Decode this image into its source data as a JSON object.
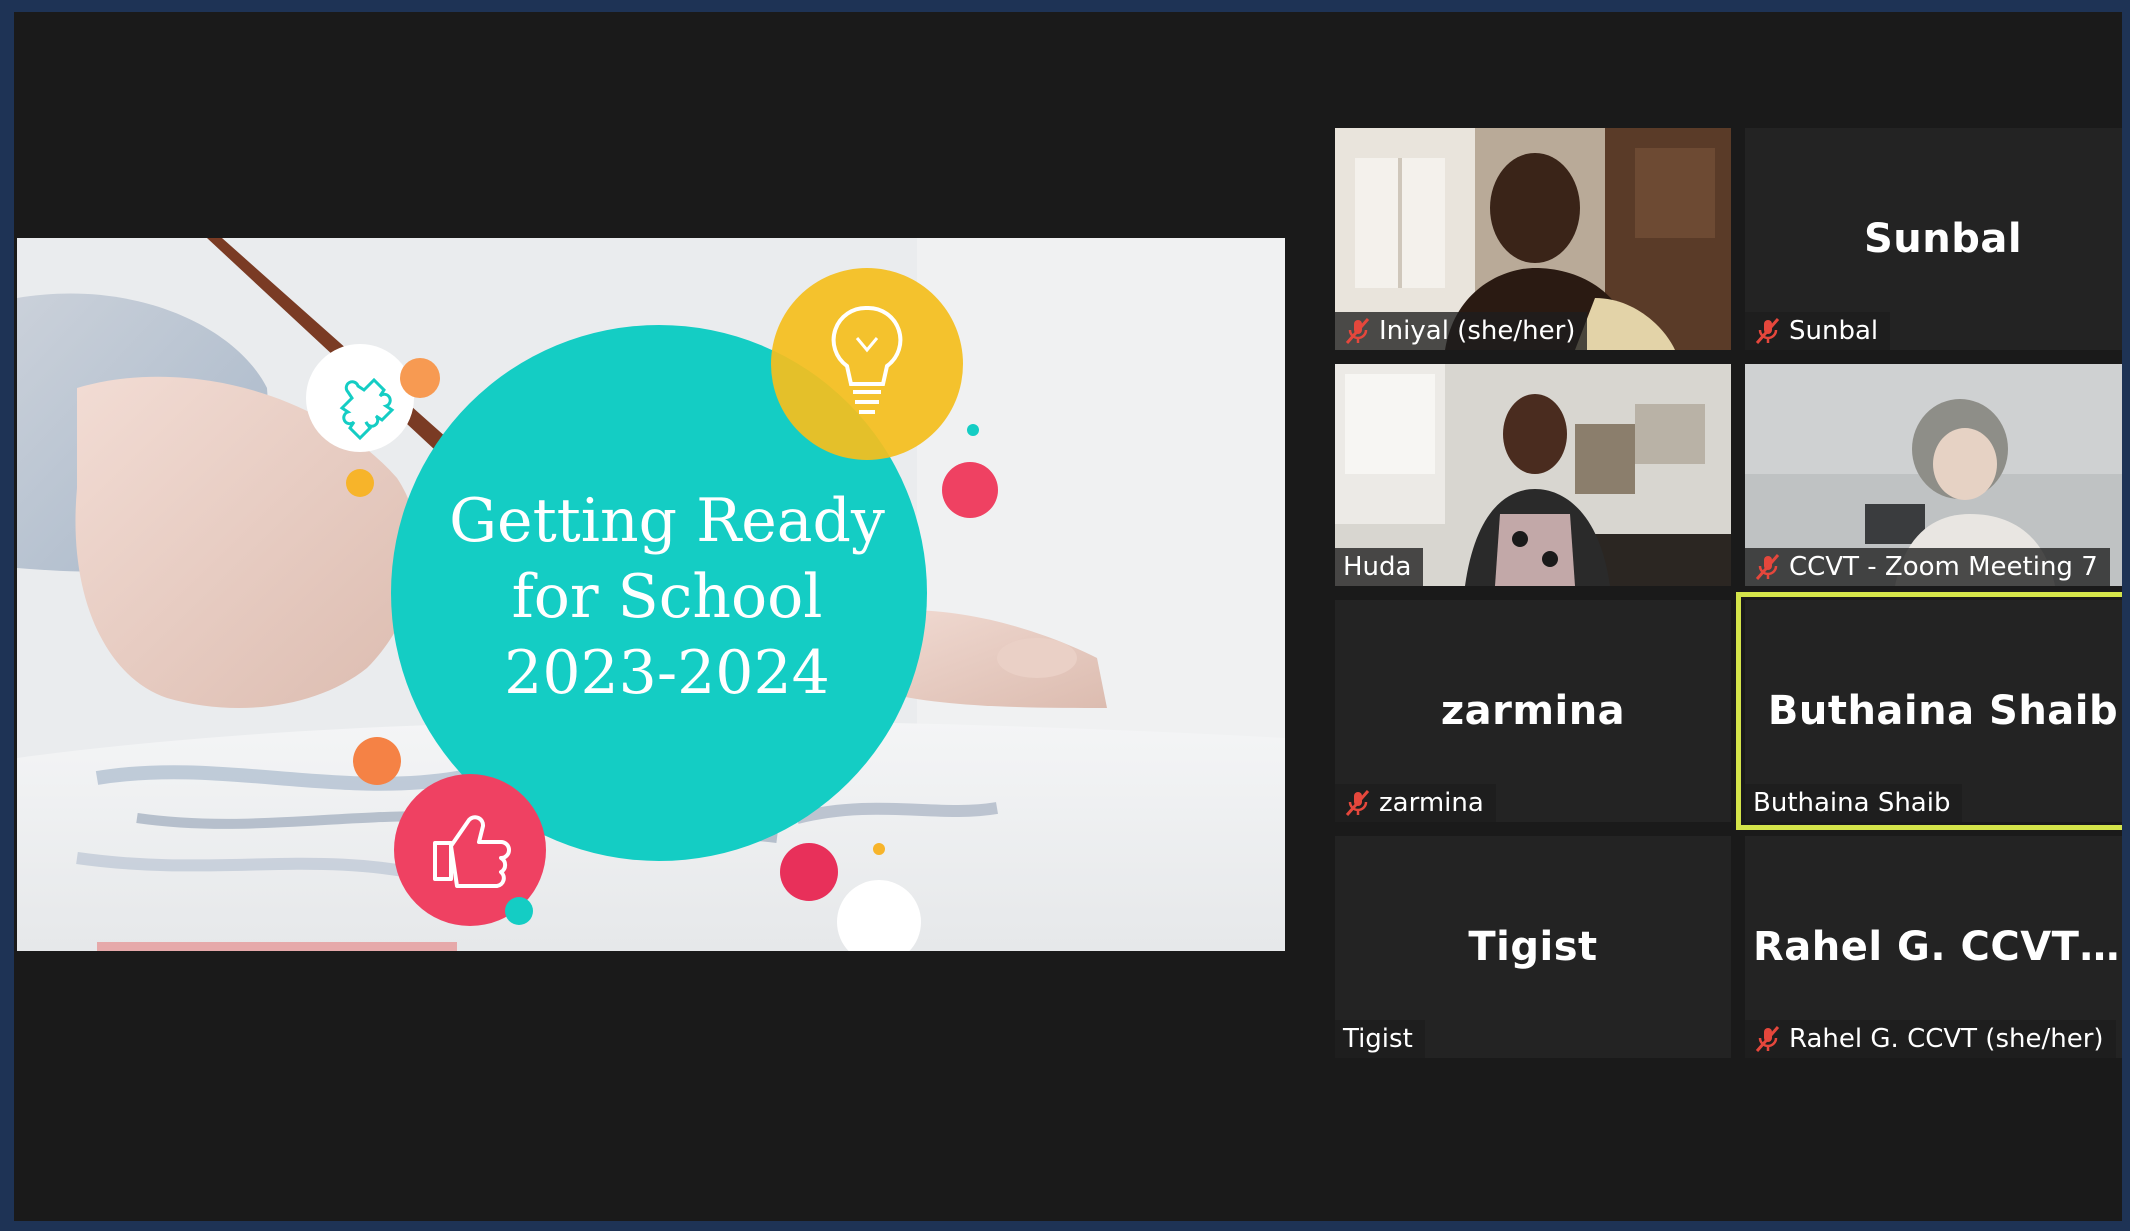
{
  "slide": {
    "title_lines": [
      "Getting Ready",
      "for School",
      "2023-2024"
    ]
  },
  "participants": [
    {
      "id": "iniyal",
      "label": "Iniyal (she/her)",
      "big_name": "",
      "muted": true,
      "video": true
    },
    {
      "id": "sunbal",
      "label": "Sunbal",
      "big_name": "Sunbal",
      "muted": true,
      "video": false
    },
    {
      "id": "huda",
      "label": "Huda",
      "big_name": "",
      "muted": false,
      "video": true
    },
    {
      "id": "ccvt",
      "label": "CCVT - Zoom Meeting 7",
      "big_name": "",
      "muted": true,
      "video": true
    },
    {
      "id": "zarmina",
      "label": "zarmina",
      "big_name": "zarmina",
      "muted": true,
      "video": false
    },
    {
      "id": "buthaina",
      "label": "Buthaina Shaib",
      "big_name": "Buthaina Shaib",
      "muted": false,
      "video": false,
      "active_speaker": true
    },
    {
      "id": "tigist",
      "label": "Tigist",
      "big_name": "Tigist",
      "muted": false,
      "video": false
    },
    {
      "id": "rahel",
      "label": "Rahel G. CCVT (she/her)",
      "big_name": "Rahel G. CCVT (...",
      "muted": true,
      "video": false
    }
  ],
  "colors": {
    "background": "#1a1a1a",
    "frame": "#1e3355",
    "active_speaker_border": "#d4e44a",
    "slide_circle": "#14cdc4",
    "mute_icon": "#e5473c"
  }
}
